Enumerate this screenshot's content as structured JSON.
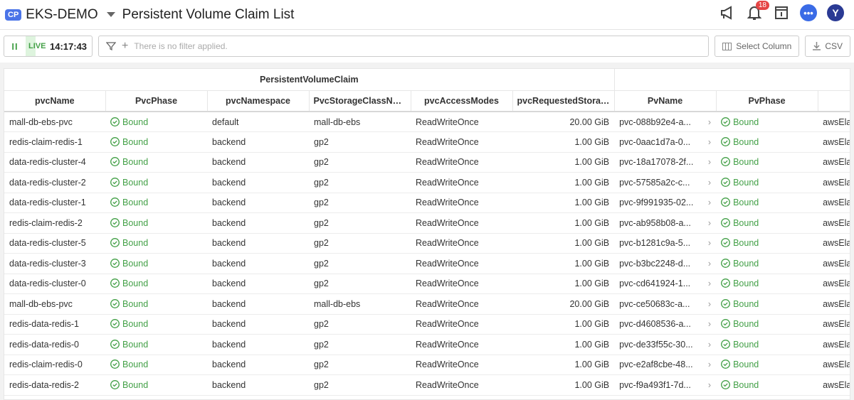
{
  "header": {
    "badge": "CP",
    "project": "EKS-DEMO",
    "title": "Persistent Volume Claim List",
    "notification_count": "18",
    "avatar_initial": "Y",
    "chat_label": "•••"
  },
  "toolbar": {
    "pause_icon": "II",
    "live_label": "LIVE",
    "time": "14:17:43",
    "filter_placeholder": "There is no filter applied.",
    "select_column": "Select Column",
    "csv": "CSV"
  },
  "table": {
    "group_header": "PersistentVolumeClaim",
    "columns": [
      "pvcName",
      "PvcPhase",
      "pvcNamespace",
      "PvcStorageClassName",
      "pvcAccessModes",
      "pvcRequestedStorage",
      "PvName",
      "PvPhase",
      ""
    ],
    "rows": [
      [
        "mall-db-ebs-pvc",
        "Bound",
        "default",
        "mall-db-ebs",
        "ReadWriteOnce",
        "20.00 GiB",
        "pvc-088b92e4-a...",
        "Bound",
        "awsEla"
      ],
      [
        "redis-claim-redis-1",
        "Bound",
        "backend",
        "gp2",
        "ReadWriteOnce",
        "1.00 GiB",
        "pvc-0aac1d7a-0...",
        "Bound",
        "awsEla"
      ],
      [
        "data-redis-cluster-4",
        "Bound",
        "backend",
        "gp2",
        "ReadWriteOnce",
        "1.00 GiB",
        "pvc-18a17078-2f...",
        "Bound",
        "awsEla"
      ],
      [
        "data-redis-cluster-2",
        "Bound",
        "backend",
        "gp2",
        "ReadWriteOnce",
        "1.00 GiB",
        "pvc-57585a2c-c...",
        "Bound",
        "awsEla"
      ],
      [
        "data-redis-cluster-1",
        "Bound",
        "backend",
        "gp2",
        "ReadWriteOnce",
        "1.00 GiB",
        "pvc-9f991935-02...",
        "Bound",
        "awsEla"
      ],
      [
        "redis-claim-redis-2",
        "Bound",
        "backend",
        "gp2",
        "ReadWriteOnce",
        "1.00 GiB",
        "pvc-ab958b08-a...",
        "Bound",
        "awsEla"
      ],
      [
        "data-redis-cluster-5",
        "Bound",
        "backend",
        "gp2",
        "ReadWriteOnce",
        "1.00 GiB",
        "pvc-b1281c9a-5...",
        "Bound",
        "awsEla"
      ],
      [
        "data-redis-cluster-3",
        "Bound",
        "backend",
        "gp2",
        "ReadWriteOnce",
        "1.00 GiB",
        "pvc-b3bc2248-d...",
        "Bound",
        "awsEla"
      ],
      [
        "data-redis-cluster-0",
        "Bound",
        "backend",
        "gp2",
        "ReadWriteOnce",
        "1.00 GiB",
        "pvc-cd641924-1...",
        "Bound",
        "awsEla"
      ],
      [
        "mall-db-ebs-pvc",
        "Bound",
        "backend",
        "mall-db-ebs",
        "ReadWriteOnce",
        "20.00 GiB",
        "pvc-ce50683c-a...",
        "Bound",
        "awsEla"
      ],
      [
        "redis-data-redis-1",
        "Bound",
        "backend",
        "gp2",
        "ReadWriteOnce",
        "1.00 GiB",
        "pvc-d4608536-a...",
        "Bound",
        "awsEla"
      ],
      [
        "redis-data-redis-0",
        "Bound",
        "backend",
        "gp2",
        "ReadWriteOnce",
        "1.00 GiB",
        "pvc-de33f55c-30...",
        "Bound",
        "awsEla"
      ],
      [
        "redis-claim-redis-0",
        "Bound",
        "backend",
        "gp2",
        "ReadWriteOnce",
        "1.00 GiB",
        "pvc-e2af8cbe-48...",
        "Bound",
        "awsEla"
      ],
      [
        "redis-data-redis-2",
        "Bound",
        "backend",
        "gp2",
        "ReadWriteOnce",
        "1.00 GiB",
        "pvc-f9a493f1-7d...",
        "Bound",
        "awsEla"
      ]
    ]
  },
  "colors": {
    "accent": "#4a74e8",
    "bound": "#43a047",
    "badge": "#e54545"
  }
}
